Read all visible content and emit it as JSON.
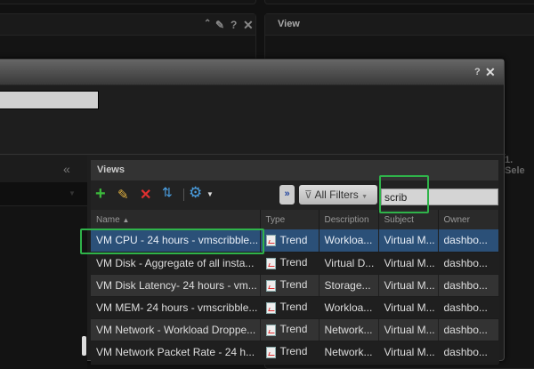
{
  "top_panel": {
    "title": ""
  },
  "view_panel": {
    "title": "View"
  },
  "modal": {
    "title": "",
    "name_input": ""
  },
  "side_text": "1. Sele",
  "left_pane": {
    "collapse": "«"
  },
  "views": {
    "title": "Views",
    "toolbar": {
      "add": "add-icon",
      "edit": "edit-icon",
      "delete": "delete-icon",
      "import": "import-export-icon",
      "settings": "gear-icon"
    },
    "expand_label": "»",
    "filter_label": "All Filters",
    "search_value": "scrib",
    "columns": [
      "Name",
      "Type",
      "Description",
      "Subject",
      "Owner"
    ],
    "sort_indicator": "▲",
    "rows": [
      {
        "name": "VM CPU - 24 hours - vmscribble...",
        "type": "Trend",
        "description": "Workloa...",
        "subject": "Virtual M...",
        "owner": "dashbo..."
      },
      {
        "name": "VM Disk - Aggregate of all insta...",
        "type": "Trend",
        "description": "Virtual D...",
        "subject": "Virtual M...",
        "owner": "dashbo..."
      },
      {
        "name": "VM Disk Latency- 24 hours - vm...",
        "type": "Trend",
        "description": "Storage...",
        "subject": "Virtual M...",
        "owner": "dashbo..."
      },
      {
        "name": "VM MEM- 24 hours - vmscribble...",
        "type": "Trend",
        "description": "Workloa...",
        "subject": "Virtual M...",
        "owner": "dashbo..."
      },
      {
        "name": "VM Network - Workload Droppe...",
        "type": "Trend",
        "description": "Network...",
        "subject": "Virtual M...",
        "owner": "dashbo..."
      },
      {
        "name": "VM Network Packet Rate - 24 h...",
        "type": "Trend",
        "description": "Network...",
        "subject": "Virtual M...",
        "owner": "dashbo..."
      }
    ]
  },
  "colors": {
    "selected_row": "#2b5078",
    "highlight": "#2fb34a"
  }
}
